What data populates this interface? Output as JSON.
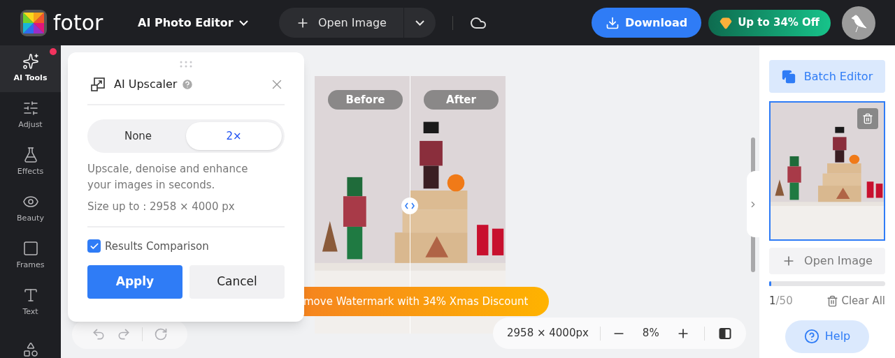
{
  "header": {
    "logo": "fotor",
    "product_menu": "AI Photo Editor",
    "open_image": "Open Image",
    "download": "Download",
    "promo": "Up to 34% Off"
  },
  "sidebar": {
    "items": [
      {
        "label": "AI Tools",
        "selected": true,
        "badge": true
      },
      {
        "label": "Adjust",
        "selected": false,
        "badge": false
      },
      {
        "label": "Effects",
        "selected": false,
        "badge": false
      },
      {
        "label": "Beauty",
        "selected": false,
        "badge": false
      },
      {
        "label": "Frames",
        "selected": false,
        "badge": false
      },
      {
        "label": "Text",
        "selected": false,
        "badge": false
      },
      {
        "selected": false,
        "badge": false
      }
    ]
  },
  "upscaler_panel": {
    "title": "AI Upscaler",
    "options": [
      {
        "label": "None",
        "selected": false
      },
      {
        "label": "2×",
        "selected": true
      }
    ],
    "description": "Upscale, denoise and enhance your images in seconds.",
    "size_limit": "Size up to : 2958 × 4000 px",
    "results_comparison": {
      "label": "Results Comparison",
      "checked": true
    },
    "apply": "Apply",
    "cancel": "Cancel"
  },
  "preview": {
    "before_label": "Before",
    "after_label": "After",
    "watermark_banner": "move Watermark with 34% Xmas Discount"
  },
  "zoom_bar": {
    "dimensions": "2958 × 4000px",
    "zoom": "8%"
  },
  "right_panel": {
    "batch_editor": "Batch Editor",
    "open_image": "Open Image",
    "progress": {
      "level": 0.02
    },
    "count": "1",
    "total": "/50",
    "clear_all": "Clear All",
    "help": "Help"
  }
}
